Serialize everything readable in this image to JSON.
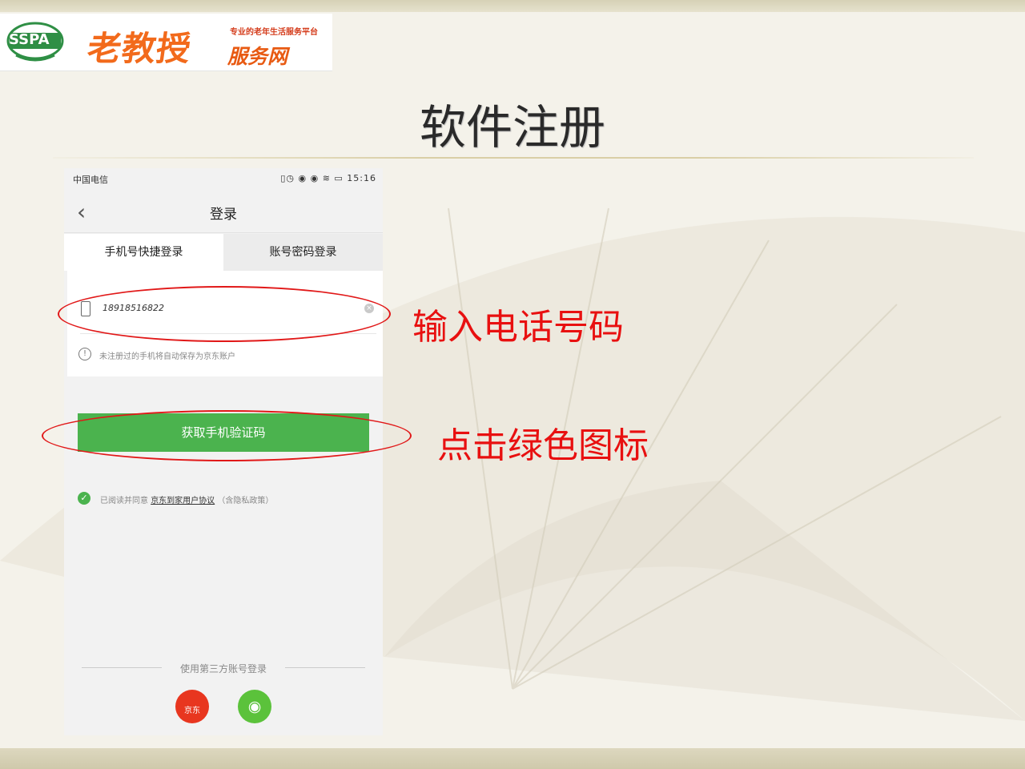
{
  "logo": {
    "badge_text": "SSPA",
    "brand_name": "老教授",
    "brand_suffix": "服务网",
    "tagline": "专业的老年生活服务平台"
  },
  "slide": {
    "title": "软件注册"
  },
  "phone": {
    "status_bar": {
      "carrier": "中国电信",
      "icons_text": "▯◷ ◉ ◉ ≋ ▭ 15:16"
    },
    "nav": {
      "back_icon": "‹",
      "title": "登录"
    },
    "tabs": [
      {
        "label": "手机号快捷登录",
        "active": true
      },
      {
        "label": "账号密码登录",
        "active": false
      }
    ],
    "form": {
      "phone_value": "18918516822",
      "notice": "未注册过的手机将自动保存为京东账户"
    },
    "verify_button": "获取手机验证码",
    "agreement": {
      "prefix": "已阅读并同意",
      "link": "京东到家用户协议",
      "suffix": "（含隐私政策）"
    },
    "third_party": {
      "label": "使用第三方账号登录",
      "jd_label": "京东"
    }
  },
  "annotations": {
    "phone_input_note": "输入电话号码",
    "button_note": "点击绿色图标"
  },
  "colors": {
    "accent_green": "#4bb34e",
    "annotation_red": "#e81010",
    "brand_orange": "#f26a1b",
    "jd_red": "#e8361f",
    "wechat_green": "#5bc23b"
  }
}
